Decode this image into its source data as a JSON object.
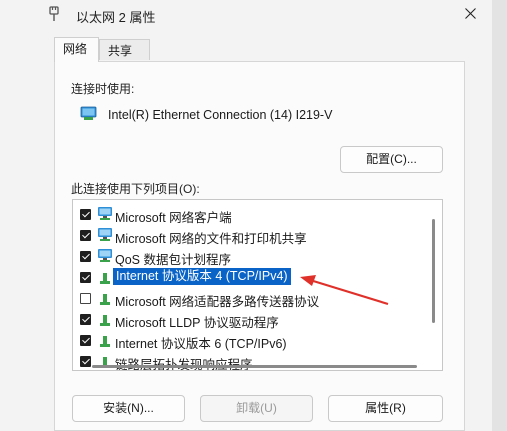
{
  "window": {
    "title": "以太网 2 属性"
  },
  "tabs": [
    {
      "label": "网络"
    },
    {
      "label": "共享"
    }
  ],
  "connection": {
    "label": "连接时使用:",
    "adapter": "Intel(R) Ethernet Connection (14) I219-V",
    "configure_button": "配置(C)..."
  },
  "items": {
    "label": "此连接使用下列项目(O):",
    "list": [
      {
        "label": "Microsoft 网络客户端",
        "checked": true,
        "icon": "network-client-icon"
      },
      {
        "label": "Microsoft 网络的文件和打印机共享",
        "checked": true,
        "icon": "file-printer-sharing-icon"
      },
      {
        "label": "QoS 数据包计划程序",
        "checked": true,
        "icon": "qos-scheduler-icon"
      },
      {
        "label": "Internet 协议版本 4 (TCP/IPv4)",
        "checked": true,
        "icon": "protocol-icon",
        "selected": true
      },
      {
        "label": "Microsoft 网络适配器多路传送器协议",
        "checked": false,
        "icon": "protocol-icon"
      },
      {
        "label": "Microsoft LLDP 协议驱动程序",
        "checked": true,
        "icon": "protocol-icon"
      },
      {
        "label": "Internet 协议版本 6 (TCP/IPv6)",
        "checked": true,
        "icon": "protocol-icon"
      },
      {
        "label": "链路层拓扑发现响应程序",
        "checked": true,
        "icon": "protocol-icon"
      }
    ]
  },
  "buttons": {
    "install": "安装(N)...",
    "uninstall": "卸载(U)",
    "properties": "属性(R)"
  },
  "colors": {
    "selection": "#0a64c8",
    "annotation_arrow": "#e0302a",
    "protocol_icon": "#3aa24a",
    "monitor_icon": "#2f8fd6"
  }
}
